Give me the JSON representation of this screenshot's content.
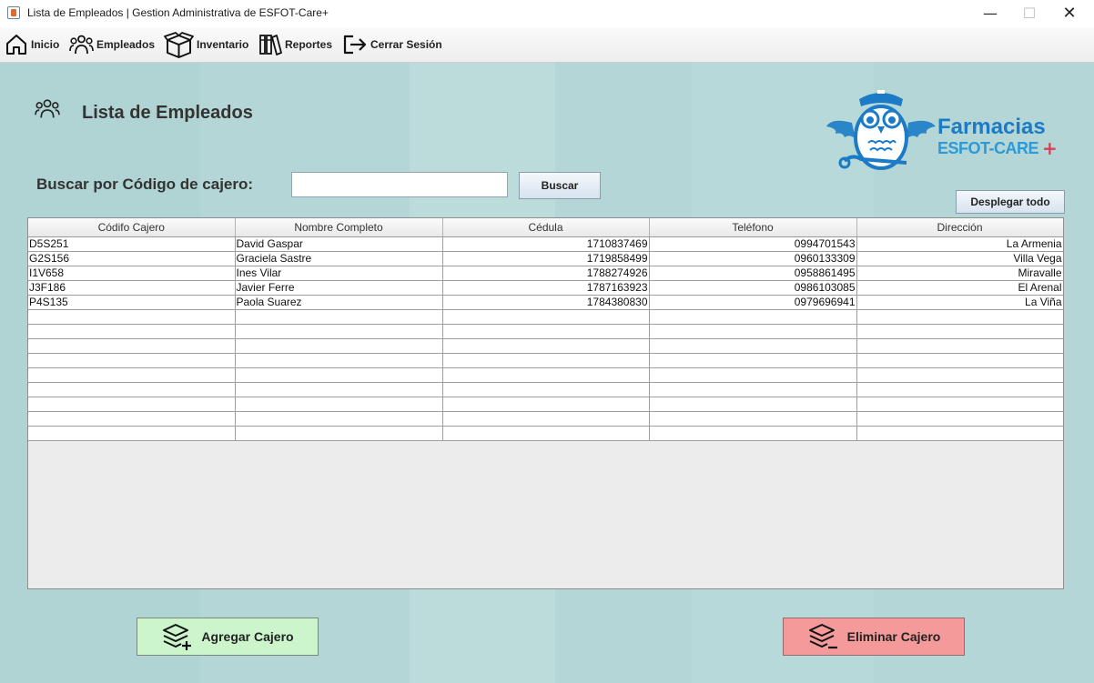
{
  "window": {
    "title": "Lista de Empleados | Gestion Administrativa de ESFOT-Care+",
    "minimize": "—",
    "maximize": "☐",
    "close": "✕"
  },
  "menu": {
    "inicio": "Inicio",
    "empleados": "Empleados",
    "inventario": "Inventario",
    "reportes": "Reportes",
    "cerrar": "Cerrar Sesión"
  },
  "page": {
    "title": "Lista de Empleados"
  },
  "logo": {
    "word": "Farmacias",
    "sub": "ESFOT-CARE",
    "plus": "+"
  },
  "search": {
    "label": "Buscar por Código de cajero:",
    "value": "",
    "button": "Buscar"
  },
  "desplegar": "Desplegar todo",
  "table": {
    "headers": [
      "Códifo Cajero",
      "Nombre Completo",
      "Cédula",
      "Teléfono",
      "Dirección"
    ],
    "rows": [
      [
        "D5S251",
        "David Gaspar",
        "1710837469",
        "0994701543",
        "La Armenia"
      ],
      [
        "G2S156",
        "Graciela Sastre",
        "1719858499",
        "0960133309",
        "Villa Vega"
      ],
      [
        "I1V658",
        "Ines Vilar",
        "1788274926",
        "0958861495",
        "Miravalle"
      ],
      [
        "J3F186",
        "Javier Ferre",
        "1787163923",
        "0986103085",
        "El Arenal"
      ],
      [
        "P4S135",
        "Paola Suarez",
        "1784380830",
        "0979696941",
        "La Viña"
      ]
    ],
    "empty_rows": 9
  },
  "actions": {
    "add": "Agregar Cajero",
    "delete": "Eliminar Cajero"
  },
  "colors": {
    "background": "#b4d6d6",
    "add_button": "#ccf5cc",
    "delete_button": "#f59a9a",
    "brand_blue": "#1c7bc6"
  }
}
